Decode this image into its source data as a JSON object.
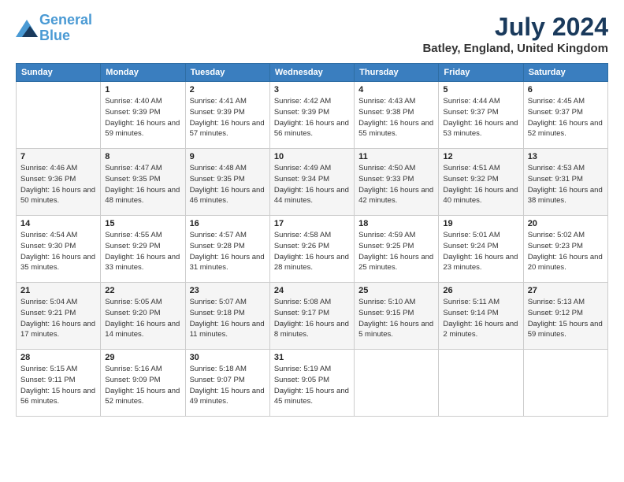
{
  "logo": {
    "line1": "General",
    "line2": "Blue"
  },
  "title": "July 2024",
  "subtitle": "Batley, England, United Kingdom",
  "days_header": [
    "Sunday",
    "Monday",
    "Tuesday",
    "Wednesday",
    "Thursday",
    "Friday",
    "Saturday"
  ],
  "weeks": [
    [
      {
        "day": "",
        "sunrise": "",
        "sunset": "",
        "daylight": ""
      },
      {
        "day": "1",
        "sunrise": "Sunrise: 4:40 AM",
        "sunset": "Sunset: 9:39 PM",
        "daylight": "Daylight: 16 hours and 59 minutes."
      },
      {
        "day": "2",
        "sunrise": "Sunrise: 4:41 AM",
        "sunset": "Sunset: 9:39 PM",
        "daylight": "Daylight: 16 hours and 57 minutes."
      },
      {
        "day": "3",
        "sunrise": "Sunrise: 4:42 AM",
        "sunset": "Sunset: 9:39 PM",
        "daylight": "Daylight: 16 hours and 56 minutes."
      },
      {
        "day": "4",
        "sunrise": "Sunrise: 4:43 AM",
        "sunset": "Sunset: 9:38 PM",
        "daylight": "Daylight: 16 hours and 55 minutes."
      },
      {
        "day": "5",
        "sunrise": "Sunrise: 4:44 AM",
        "sunset": "Sunset: 9:37 PM",
        "daylight": "Daylight: 16 hours and 53 minutes."
      },
      {
        "day": "6",
        "sunrise": "Sunrise: 4:45 AM",
        "sunset": "Sunset: 9:37 PM",
        "daylight": "Daylight: 16 hours and 52 minutes."
      }
    ],
    [
      {
        "day": "7",
        "sunrise": "Sunrise: 4:46 AM",
        "sunset": "Sunset: 9:36 PM",
        "daylight": "Daylight: 16 hours and 50 minutes."
      },
      {
        "day": "8",
        "sunrise": "Sunrise: 4:47 AM",
        "sunset": "Sunset: 9:35 PM",
        "daylight": "Daylight: 16 hours and 48 minutes."
      },
      {
        "day": "9",
        "sunrise": "Sunrise: 4:48 AM",
        "sunset": "Sunset: 9:35 PM",
        "daylight": "Daylight: 16 hours and 46 minutes."
      },
      {
        "day": "10",
        "sunrise": "Sunrise: 4:49 AM",
        "sunset": "Sunset: 9:34 PM",
        "daylight": "Daylight: 16 hours and 44 minutes."
      },
      {
        "day": "11",
        "sunrise": "Sunrise: 4:50 AM",
        "sunset": "Sunset: 9:33 PM",
        "daylight": "Daylight: 16 hours and 42 minutes."
      },
      {
        "day": "12",
        "sunrise": "Sunrise: 4:51 AM",
        "sunset": "Sunset: 9:32 PM",
        "daylight": "Daylight: 16 hours and 40 minutes."
      },
      {
        "day": "13",
        "sunrise": "Sunrise: 4:53 AM",
        "sunset": "Sunset: 9:31 PM",
        "daylight": "Daylight: 16 hours and 38 minutes."
      }
    ],
    [
      {
        "day": "14",
        "sunrise": "Sunrise: 4:54 AM",
        "sunset": "Sunset: 9:30 PM",
        "daylight": "Daylight: 16 hours and 35 minutes."
      },
      {
        "day": "15",
        "sunrise": "Sunrise: 4:55 AM",
        "sunset": "Sunset: 9:29 PM",
        "daylight": "Daylight: 16 hours and 33 minutes."
      },
      {
        "day": "16",
        "sunrise": "Sunrise: 4:57 AM",
        "sunset": "Sunset: 9:28 PM",
        "daylight": "Daylight: 16 hours and 31 minutes."
      },
      {
        "day": "17",
        "sunrise": "Sunrise: 4:58 AM",
        "sunset": "Sunset: 9:26 PM",
        "daylight": "Daylight: 16 hours and 28 minutes."
      },
      {
        "day": "18",
        "sunrise": "Sunrise: 4:59 AM",
        "sunset": "Sunset: 9:25 PM",
        "daylight": "Daylight: 16 hours and 25 minutes."
      },
      {
        "day": "19",
        "sunrise": "Sunrise: 5:01 AM",
        "sunset": "Sunset: 9:24 PM",
        "daylight": "Daylight: 16 hours and 23 minutes."
      },
      {
        "day": "20",
        "sunrise": "Sunrise: 5:02 AM",
        "sunset": "Sunset: 9:23 PM",
        "daylight": "Daylight: 16 hours and 20 minutes."
      }
    ],
    [
      {
        "day": "21",
        "sunrise": "Sunrise: 5:04 AM",
        "sunset": "Sunset: 9:21 PM",
        "daylight": "Daylight: 16 hours and 17 minutes."
      },
      {
        "day": "22",
        "sunrise": "Sunrise: 5:05 AM",
        "sunset": "Sunset: 9:20 PM",
        "daylight": "Daylight: 16 hours and 14 minutes."
      },
      {
        "day": "23",
        "sunrise": "Sunrise: 5:07 AM",
        "sunset": "Sunset: 9:18 PM",
        "daylight": "Daylight: 16 hours and 11 minutes."
      },
      {
        "day": "24",
        "sunrise": "Sunrise: 5:08 AM",
        "sunset": "Sunset: 9:17 PM",
        "daylight": "Daylight: 16 hours and 8 minutes."
      },
      {
        "day": "25",
        "sunrise": "Sunrise: 5:10 AM",
        "sunset": "Sunset: 9:15 PM",
        "daylight": "Daylight: 16 hours and 5 minutes."
      },
      {
        "day": "26",
        "sunrise": "Sunrise: 5:11 AM",
        "sunset": "Sunset: 9:14 PM",
        "daylight": "Daylight: 16 hours and 2 minutes."
      },
      {
        "day": "27",
        "sunrise": "Sunrise: 5:13 AM",
        "sunset": "Sunset: 9:12 PM",
        "daylight": "Daylight: 15 hours and 59 minutes."
      }
    ],
    [
      {
        "day": "28",
        "sunrise": "Sunrise: 5:15 AM",
        "sunset": "Sunset: 9:11 PM",
        "daylight": "Daylight: 15 hours and 56 minutes."
      },
      {
        "day": "29",
        "sunrise": "Sunrise: 5:16 AM",
        "sunset": "Sunset: 9:09 PM",
        "daylight": "Daylight: 15 hours and 52 minutes."
      },
      {
        "day": "30",
        "sunrise": "Sunrise: 5:18 AM",
        "sunset": "Sunset: 9:07 PM",
        "daylight": "Daylight: 15 hours and 49 minutes."
      },
      {
        "day": "31",
        "sunrise": "Sunrise: 5:19 AM",
        "sunset": "Sunset: 9:05 PM",
        "daylight": "Daylight: 15 hours and 45 minutes."
      },
      {
        "day": "",
        "sunrise": "",
        "sunset": "",
        "daylight": ""
      },
      {
        "day": "",
        "sunrise": "",
        "sunset": "",
        "daylight": ""
      },
      {
        "day": "",
        "sunrise": "",
        "sunset": "",
        "daylight": ""
      }
    ]
  ]
}
